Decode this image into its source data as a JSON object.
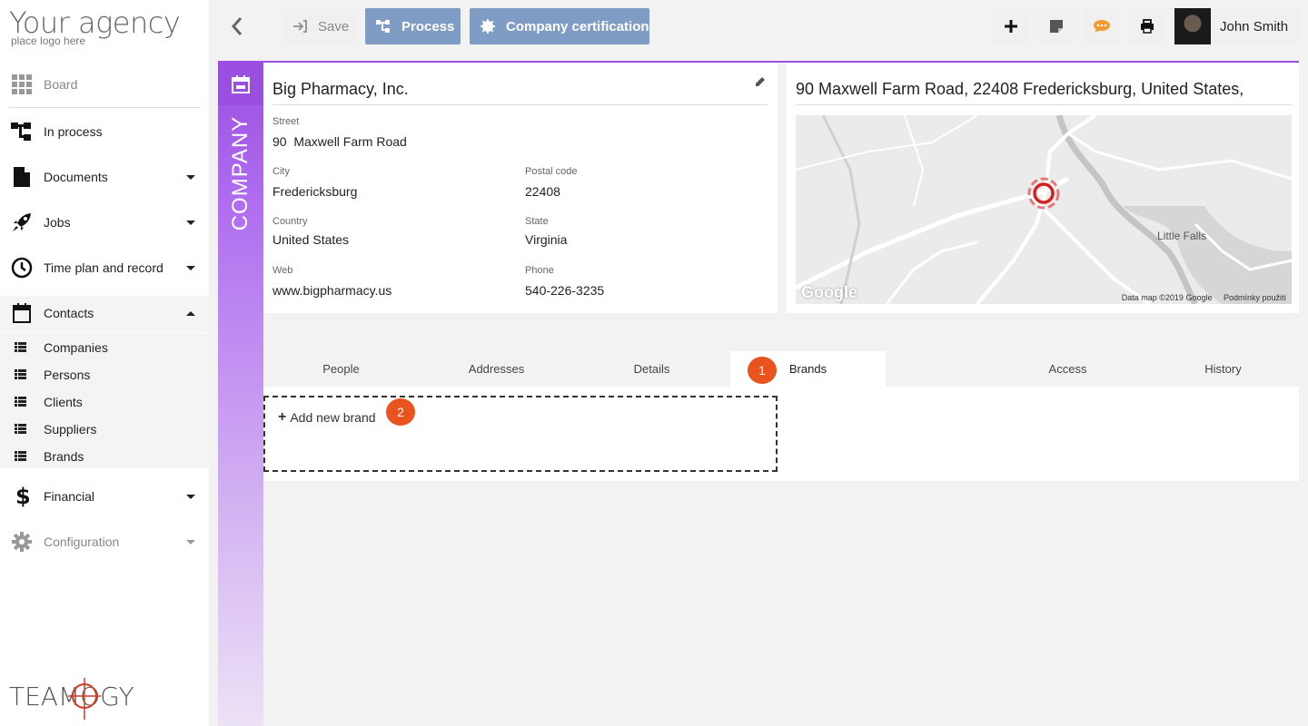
{
  "logo": {
    "title": "Your agency",
    "subtitle": "place logo here"
  },
  "sidebar": {
    "items": [
      {
        "label": "Board"
      },
      {
        "label": "In process"
      },
      {
        "label": "Documents"
      },
      {
        "label": "Jobs"
      },
      {
        "label": "Time plan and record"
      },
      {
        "label": "Contacts"
      },
      {
        "label": "Financial"
      },
      {
        "label": "Configuration"
      }
    ],
    "contacts_sub": [
      {
        "label": "Companies"
      },
      {
        "label": "Persons"
      },
      {
        "label": "Clients"
      },
      {
        "label": "Suppliers"
      },
      {
        "label": "Brands"
      }
    ],
    "brand_footer": "TEAMOGY"
  },
  "toolbar": {
    "save_label": "Save",
    "process_label": "Process",
    "cert_label": "Company certification",
    "user_name": "John Smith"
  },
  "band": {
    "label": "COMPANY",
    "color": "#9b4fe0"
  },
  "company": {
    "name": "Big Pharmacy, Inc.",
    "fields": {
      "street_label": "Street",
      "street": "90  Maxwell Farm Road",
      "city_label": "City",
      "city": "Fredericksburg",
      "postal_label": "Postal code",
      "postal": "22408",
      "country_label": "Country",
      "country": "United States",
      "state_label": "State",
      "state": "Virginia",
      "web_label": "Web",
      "web": "www.bigpharmacy.us",
      "phone_label": "Phone",
      "phone": "540-226-3235"
    }
  },
  "map": {
    "title": "90 Maxwell Farm Road, 22408 Fredericksburg, United States,",
    "place_label": "Little Falls",
    "google": "Google",
    "attribution": "Data map ©2019 Google     Podmínky použití"
  },
  "tabs": [
    {
      "label": "People"
    },
    {
      "label": "Addresses"
    },
    {
      "label": "Details"
    },
    {
      "label": "Brands"
    },
    {
      "label": ""
    },
    {
      "label": "Access"
    },
    {
      "label": "History"
    }
  ],
  "brands_panel": {
    "add_label": "Add new brand"
  },
  "badges": {
    "one": "1",
    "two": "2",
    "color": "#e8531e"
  }
}
